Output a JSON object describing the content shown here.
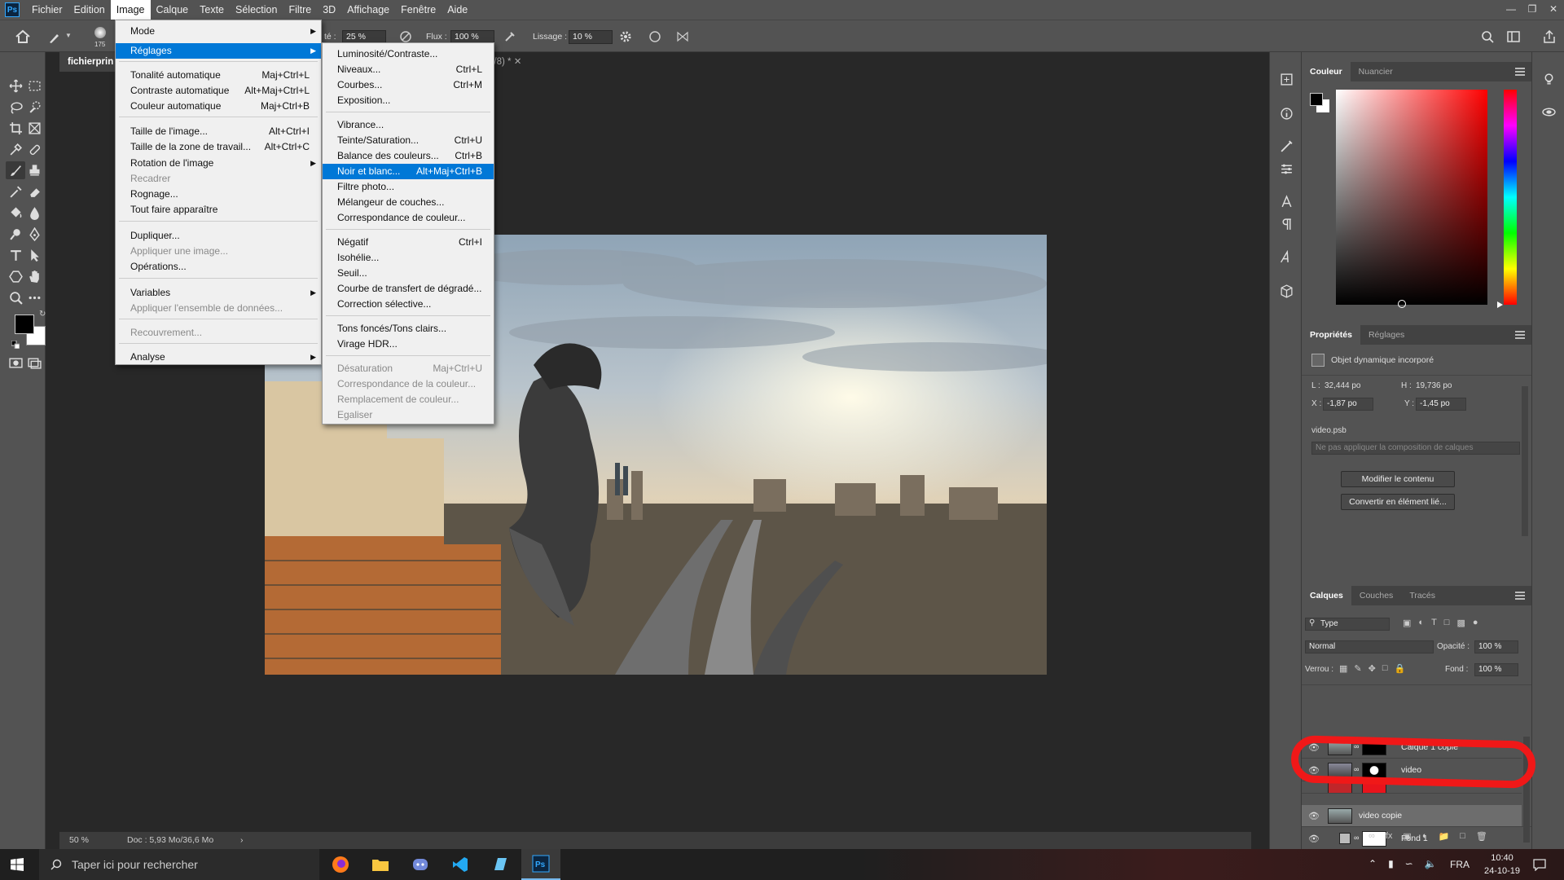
{
  "app": {
    "logo": "Ps"
  },
  "menubar": {
    "items": [
      "Fichier",
      "Edition",
      "Image",
      "Calque",
      "Texte",
      "Sélection",
      "Filtre",
      "3D",
      "Affichage",
      "Fenêtre",
      "Aide"
    ],
    "active": "Image"
  },
  "options": {
    "brush_size": "175",
    "opacity_label": "té :",
    "opacity_value": "25 %",
    "flux_label": "Flux :",
    "flux_value": "100 %",
    "lissage_label": "Lissage :",
    "lissage_value": "10 %"
  },
  "document": {
    "tab_title": "fichierprin",
    "second_tab": "3/8) *",
    "zoom": "50 %",
    "doc_info": "Doc : 5,93 Mo/36,6 Mo"
  },
  "image_menu": {
    "items": [
      {
        "label": "Mode",
        "shortcut": "",
        "submenu": true,
        "disabled": false
      },
      {
        "label": "Réglages",
        "shortcut": "",
        "submenu": true,
        "disabled": false,
        "highlighted": true
      },
      {
        "label": "Tonalité automatique",
        "shortcut": "Maj+Ctrl+L",
        "disabled": false
      },
      {
        "label": "Contraste automatique",
        "shortcut": "Alt+Maj+Ctrl+L",
        "disabled": false
      },
      {
        "label": "Couleur automatique",
        "shortcut": "Maj+Ctrl+B",
        "disabled": false
      },
      {
        "label": "Taille de l'image...",
        "shortcut": "Alt+Ctrl+I",
        "disabled": false
      },
      {
        "label": "Taille de la zone de travail...",
        "shortcut": "Alt+Ctrl+C",
        "disabled": false
      },
      {
        "label": "Rotation de l'image",
        "shortcut": "",
        "submenu": true,
        "disabled": false
      },
      {
        "label": "Recadrer",
        "shortcut": "",
        "disabled": true
      },
      {
        "label": "Rognage...",
        "shortcut": "",
        "disabled": false
      },
      {
        "label": "Tout faire apparaître",
        "shortcut": "",
        "disabled": false
      },
      {
        "label": "Dupliquer...",
        "shortcut": "",
        "disabled": false
      },
      {
        "label": "Appliquer une image...",
        "shortcut": "",
        "disabled": true
      },
      {
        "label": "Opérations...",
        "shortcut": "",
        "disabled": false
      },
      {
        "label": "Variables",
        "shortcut": "",
        "submenu": true,
        "disabled": false
      },
      {
        "label": "Appliquer l'ensemble de données...",
        "shortcut": "",
        "disabled": true
      },
      {
        "label": "Recouvrement...",
        "shortcut": "",
        "disabled": true
      },
      {
        "label": "Analyse",
        "shortcut": "",
        "submenu": true,
        "disabled": false
      }
    ]
  },
  "reglages_menu": {
    "items": [
      {
        "label": "Luminosité/Contraste...",
        "shortcut": ""
      },
      {
        "label": "Niveaux...",
        "shortcut": "Ctrl+L"
      },
      {
        "label": "Courbes...",
        "shortcut": "Ctrl+M"
      },
      {
        "label": "Exposition...",
        "shortcut": ""
      },
      {
        "label": "Vibrance...",
        "shortcut": ""
      },
      {
        "label": "Teinte/Saturation...",
        "shortcut": "Ctrl+U"
      },
      {
        "label": "Balance des couleurs...",
        "shortcut": "Ctrl+B"
      },
      {
        "label": "Noir et blanc...",
        "shortcut": "Alt+Maj+Ctrl+B",
        "highlighted": true
      },
      {
        "label": "Filtre photo...",
        "shortcut": ""
      },
      {
        "label": "Mélangeur de couches...",
        "shortcut": ""
      },
      {
        "label": "Correspondance de couleur...",
        "shortcut": ""
      },
      {
        "label": "Négatif",
        "shortcut": "Ctrl+I"
      },
      {
        "label": "Isohélie...",
        "shortcut": ""
      },
      {
        "label": "Seuil...",
        "shortcut": ""
      },
      {
        "label": "Courbe de transfert de dégradé...",
        "shortcut": ""
      },
      {
        "label": "Correction sélective...",
        "shortcut": ""
      },
      {
        "label": "Tons foncés/Tons clairs...",
        "shortcut": ""
      },
      {
        "label": "Virage HDR...",
        "shortcut": ""
      },
      {
        "label": "Désaturation",
        "shortcut": "Maj+Ctrl+U",
        "disabled": true
      },
      {
        "label": "Correspondance de la couleur...",
        "shortcut": "",
        "disabled": true
      },
      {
        "label": "Remplacement de couleur...",
        "shortcut": "",
        "disabled": true
      },
      {
        "label": "Egaliser",
        "shortcut": "",
        "disabled": true
      }
    ]
  },
  "color_panel": {
    "tabs": [
      "Couleur",
      "Nuancier"
    ]
  },
  "properties_panel": {
    "tabs": [
      "Propriétés",
      "Réglages"
    ],
    "object_type": "Objet dynamique incorporé",
    "L_label": "L :",
    "L_value": "32,444 po",
    "H_label": "H :",
    "H_value": "19,736 po",
    "X_label": "X :",
    "X_value": "-1,87 po",
    "Y_label": "Y :",
    "Y_value": "-1,45 po",
    "file": "video.psb",
    "composition": "Ne pas appliquer la composition de calques",
    "btn_modify": "Modifier le contenu",
    "btn_convert": "Convertir en élément lié..."
  },
  "layers_panel": {
    "tabs": [
      "Calques",
      "Couches",
      "Tracés"
    ],
    "filter": "Type",
    "blend_mode": "Normal",
    "opacity_label": "Opacité :",
    "opacity_value": "100 %",
    "lock_label": "Verrou :",
    "fill_label": "Fond :",
    "fill_value": "100 %",
    "layers": [
      {
        "name": "Calque 1 copie",
        "visible": true,
        "selected": false
      },
      {
        "name": "video",
        "visible": true,
        "selected": false
      },
      {
        "name": "",
        "visible": false,
        "selected": false
      },
      {
        "name": "video copie",
        "visible": true,
        "selected": true
      },
      {
        "name": "Fond 1",
        "visible": true,
        "selected": false
      }
    ]
  },
  "taskbar": {
    "search_placeholder": "Taper ici pour rechercher",
    "lang": "FRA",
    "time": "10:40",
    "date": "24-10-19"
  },
  "colors": {
    "highlight": "#0078d7",
    "annotation_circle": "#f01818"
  }
}
